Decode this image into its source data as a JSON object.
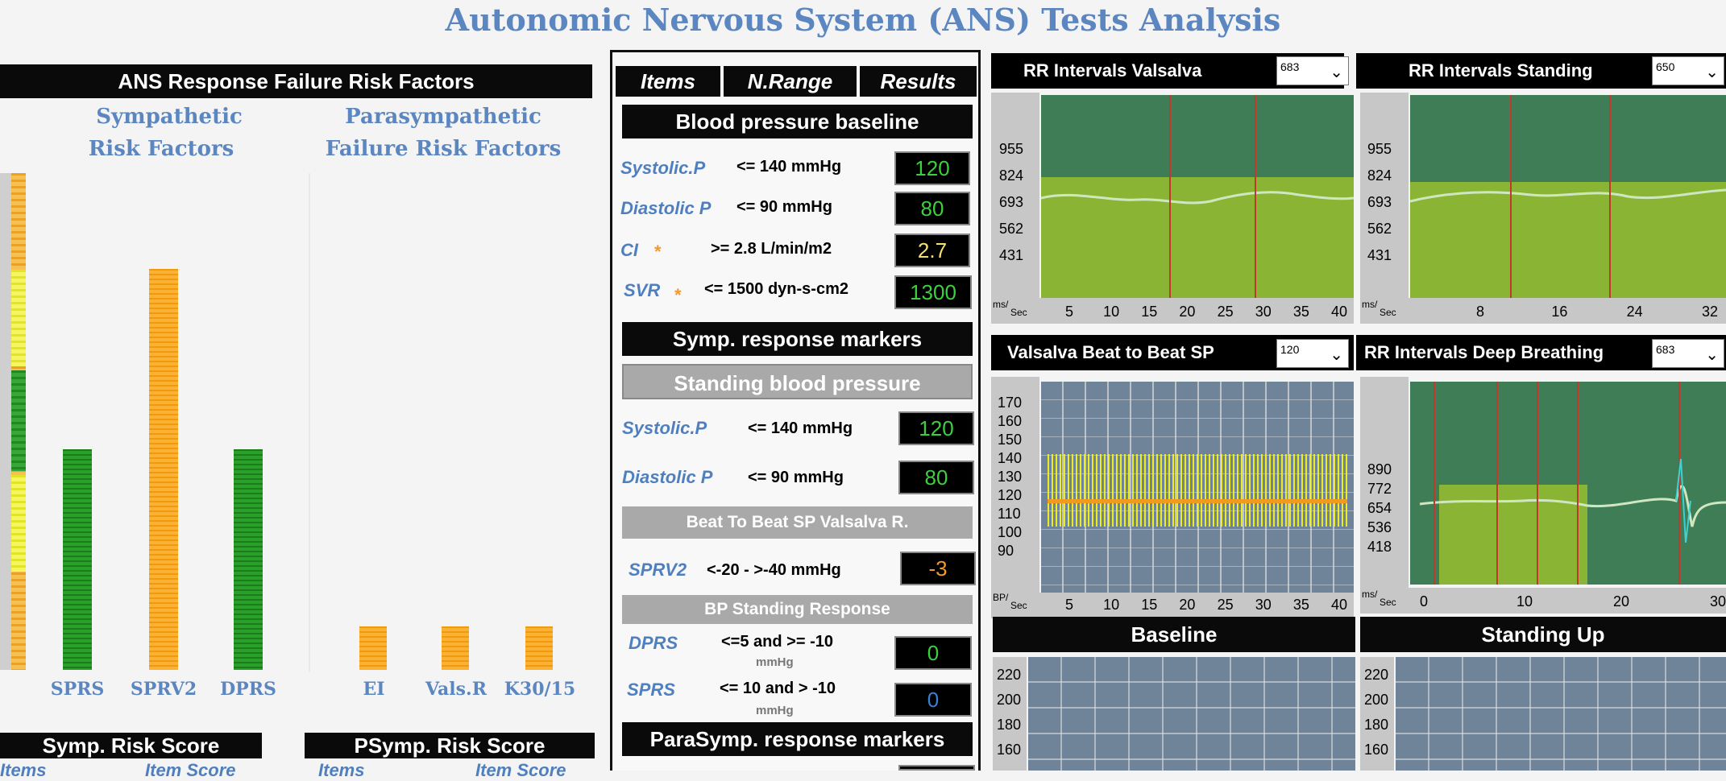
{
  "title": "Autonomic Nervous System (ANS) Tests Analysis",
  "left": {
    "header": "ANS Response Failure Risk Factors",
    "symp_title_1": "Sympathetic",
    "symp_title_2": "Risk Factors",
    "psymp_title_1": "Parasympathetic",
    "psymp_title_2": "Failure Risk Factors",
    "symp_bars": [
      {
        "label": "SPRS",
        "value": 0.49
      },
      {
        "label": "SPRV2",
        "value": 0.89
      },
      {
        "label": "DPRS",
        "value": 0.49
      }
    ],
    "psymp_bars": [
      {
        "label": "EI",
        "value": 0.1
      },
      {
        "label": "Vals.R",
        "value": 0.1
      },
      {
        "label": "K30/15",
        "value": 0.1
      }
    ],
    "symp_score": "Symp. Risk Score",
    "psymp_score": "PSymp. Risk Score",
    "score_col1": "Items",
    "score_col2": "Item Score",
    "colors": {
      "green": "#1f8a1f",
      "orange": "#f6a21a"
    }
  },
  "middle": {
    "col_items": "Items",
    "col_range": "N.Range",
    "col_results": "Results",
    "bp_baseline": "Blood pressure baseline",
    "systolic_label": "Systolic.P",
    "systolic_range": "<= 140 mmHg",
    "systolic_value": "120",
    "diastolic_label": "Diastolic P",
    "diastolic_range": "<= 90 mmHg",
    "diastolic_value": "80",
    "ci_label": "CI",
    "ci_range": ">= 2.8 L/min/m2",
    "ci_value": "2.7",
    "svr_label": "SVR",
    "svr_range": "<= 1500 dyn-s-cm2",
    "svr_value": "1300",
    "star": "*",
    "symp_markers": "Symp. response markers",
    "standing_bp": "Standing blood pressure",
    "st_systolic_label": "Systolic.P",
    "st_systolic_range": "<= 140 mmHg",
    "st_systolic_value": "120",
    "st_diastolic_label": "Diastolic P",
    "st_diastolic_range": "<= 90 mmHg",
    "st_diastolic_value": "80",
    "btb_header": "Beat To Beat SP Valsalva R.",
    "sprv2_label": "SPRV2",
    "sprv2_range": "<-20 - >-40 mmHg",
    "sprv2_value": "-3",
    "bp_standing": "BP Standing Response",
    "dprs_label": "DPRS",
    "dprs_range": "<=5 and >= -10",
    "dprs_unit": "mmHg",
    "dprs_value": "0",
    "sprs_label": "SPRS",
    "sprs_range": "<= 10 and > -10",
    "sprs_unit": "mmHg",
    "sprs_value": "0",
    "parasymp_markers": "ParaSymp. response markers"
  },
  "right": {
    "rr_valsalva": {
      "title": "RR Intervals Valsalva",
      "select": "683",
      "yticks": [
        "955",
        "824",
        "693",
        "562",
        "431"
      ],
      "xticks": [
        "5",
        "10",
        "15",
        "20",
        "25",
        "30",
        "35",
        "40"
      ],
      "unit_a": "ms/",
      "unit_b": "Sec"
    },
    "rr_standing": {
      "title": "RR Intervals Standing",
      "select": "650",
      "yticks": [
        "955",
        "824",
        "693",
        "562",
        "431"
      ],
      "xticks": [
        "8",
        "16",
        "24",
        "32"
      ],
      "unit_a": "ms/",
      "unit_b": "Sec"
    },
    "valsalva_sp": {
      "title": "Valsalva Beat to Beat SP",
      "select": "120",
      "yticks": [
        "170",
        "160",
        "150",
        "140",
        "130",
        "120",
        "110",
        "100",
        "90"
      ],
      "xticks": [
        "5",
        "10",
        "15",
        "20",
        "25",
        "30",
        "35",
        "40"
      ],
      "unit_a": "BP/",
      "unit_b": "Sec"
    },
    "rr_deep": {
      "title": "RR Intervals Deep Breathing",
      "select": "683",
      "yticks": [
        "890",
        "772",
        "654",
        "536",
        "418"
      ],
      "xticks": [
        "0",
        "10",
        "20",
        "30"
      ],
      "unit_a": "ms/",
      "unit_b": "Sec"
    },
    "baseline": {
      "title": "Baseline",
      "yticks": [
        "220",
        "200",
        "180",
        "160"
      ]
    },
    "standing_up": {
      "title": "Standing Up",
      "yticks": [
        "220",
        "200",
        "180",
        "160"
      ]
    },
    "colors": {
      "plot_dark": "#3e7d55",
      "plot_light": "#8ab534",
      "plot_grey": "#6f8399",
      "red": "#c0392b"
    }
  }
}
